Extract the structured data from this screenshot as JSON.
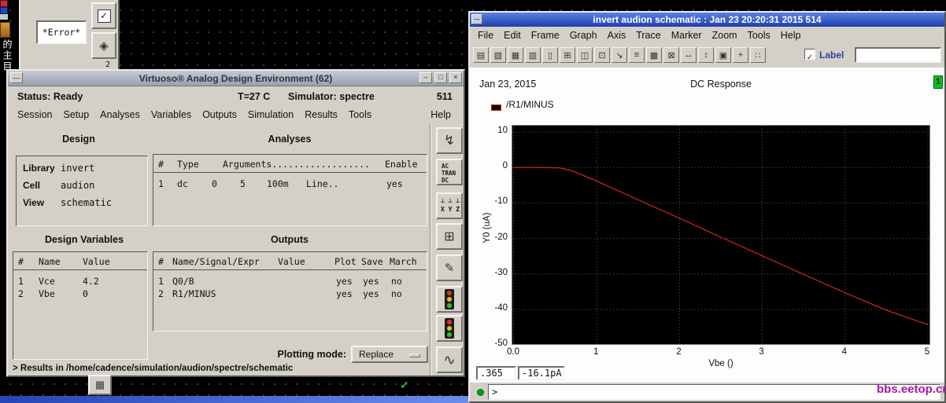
{
  "desktop": {
    "partial_icon_label": "的主目",
    "watermark": "bbs.eetop.cn",
    "check_mark": "✓",
    "minimized_icon_glyph": "▦"
  },
  "error_window": {
    "error_label": "*Error*",
    "check_icon_glyph": "✓",
    "skip_icon_glyph": "◈",
    "skip_icon_caption": "2"
  },
  "ade": {
    "title": "Virtuoso® Analog Design Environment (62)",
    "window_menu_glyph": "—",
    "minimize_glyph": "–",
    "maximize_glyph": "□",
    "close_glyph": "×",
    "status_label": "Status:",
    "status_value": "Ready",
    "temperature": "T=27 C",
    "simulator_label": "Simulator:",
    "simulator_value": "spectre",
    "run_number": "511",
    "menus": [
      "Session",
      "Setup",
      "Analyses",
      "Variables",
      "Outputs",
      "Simulation",
      "Results",
      "Tools"
    ],
    "help_menu": "Help",
    "design": {
      "title": "Design",
      "library_label": "Library",
      "library_value": "invert",
      "cell_label": "Cell",
      "cell_value": "audion",
      "view_label": "View",
      "view_value": "schematic"
    },
    "analyses": {
      "title": "Analyses",
      "columns": [
        "#",
        "Type",
        "Arguments..................",
        "Enable"
      ],
      "row": [
        "1",
        "dc",
        "0",
        "5",
        "100m",
        "Line..",
        "yes"
      ]
    },
    "design_variables": {
      "title": "Design Variables",
      "columns": [
        "#",
        "Name",
        "Value"
      ],
      "rows": [
        [
          "1",
          "Vce",
          "4.2"
        ],
        [
          "2",
          "Vbe",
          "0"
        ]
      ]
    },
    "outputs": {
      "title": "Outputs",
      "columns": [
        "#",
        "Name/Signal/Expr",
        "Value",
        "Plot",
        "Save",
        "March"
      ],
      "rows": [
        [
          "1",
          "Q0/B",
          "yes",
          "yes",
          "no"
        ],
        [
          "2",
          "R1/MINUS",
          "yes",
          "yes",
          "no"
        ]
      ]
    },
    "plotting_mode_label": "Plotting mode:",
    "plotting_mode_value": "Replace",
    "results_line": "> Results in /home/cadence/simulation/audion/spectre/schematic",
    "side_icons": {
      "probe_glyph": "↯",
      "ac_tran_dc_lines": [
        "AC",
        "TRAN",
        "DC"
      ],
      "xyz_lines": [
        "┴ ┴ ┴",
        "X Y Z"
      ],
      "outputs_setup_glyph": "⊞",
      "annotate_glyph": "✎",
      "waveform_glyph": "∿"
    }
  },
  "waveform": {
    "title": "invert audion schematic : Jan 23 20:20:31 2015 514",
    "window_menu_glyph": "—",
    "menus": [
      "File",
      "Edit",
      "Frame",
      "Graph",
      "Axis",
      "Trace",
      "Marker",
      "Zoom",
      "Tools",
      "Help"
    ],
    "toolbar_icons": [
      {
        "name": "print-icon",
        "glyph": "▤"
      },
      {
        "name": "export-image-icon",
        "glyph": "▧"
      },
      {
        "name": "grid-toggle-icon",
        "glyph": "▦"
      },
      {
        "name": "strip-mode-icon",
        "glyph": "▥"
      },
      {
        "name": "single-window-icon",
        "glyph": "▯"
      },
      {
        "name": "subwindow-icon",
        "glyph": "⊞"
      },
      {
        "name": "overlay-icon",
        "glyph": "◫"
      },
      {
        "name": "copy-graph-icon",
        "glyph": "⊡"
      },
      {
        "name": "export-data-icon",
        "glyph": "↘"
      },
      {
        "name": "edit-labels-icon",
        "glyph": "≡"
      },
      {
        "name": "fill-style-icon",
        "glyph": "▩"
      },
      {
        "name": "select-region-icon",
        "glyph": "⊠"
      },
      {
        "name": "zoom-x-icon",
        "glyph": "↔"
      },
      {
        "name": "zoom-y-icon",
        "glyph": "↕"
      },
      {
        "name": "zoom-fit-icon",
        "glyph": "▣"
      },
      {
        "name": "pan-icon",
        "glyph": "+"
      },
      {
        "name": "crosshair-icon",
        "glyph": "∷"
      }
    ],
    "label_checkbox_glyph": "✓",
    "label_checkbox_label": "Label",
    "label_field_value": "",
    "date": "Jan 23, 2015",
    "plot_title": "DC Response",
    "page_badge": "1",
    "x_readout": ".365",
    "y_readout": "-16.1pA",
    "prompt": ">",
    "chart_data": {
      "type": "line",
      "title": "DC Response",
      "xlabel": "Vbe ()",
      "ylabel": "Y0 (uA)",
      "xlim": [
        0,
        5
      ],
      "ylim": [
        -50,
        10
      ],
      "x_ticks": [
        "0.0",
        "1",
        "2",
        "3",
        "4",
        "5"
      ],
      "x_ticks_num": [
        0,
        1,
        2,
        3,
        4,
        5
      ],
      "y_ticks": [
        "10",
        "0",
        "-10",
        "-20",
        "-30",
        "-40",
        "-50"
      ],
      "y_ticks_num": [
        10,
        0,
        -10,
        -20,
        -30,
        -40,
        -50
      ],
      "grid": true,
      "background": "#000000",
      "legend_position": "top-left",
      "series": [
        {
          "name": "/R1/MINUS",
          "color": "#cc2020",
          "points": [
            [
              0,
              0
            ],
            [
              0.3,
              0
            ],
            [
              0.55,
              -0.1
            ],
            [
              0.7,
              -0.9
            ],
            [
              1,
              -3.8
            ],
            [
              1.5,
              -9.1
            ],
            [
              2,
              -14.3
            ],
            [
              2.5,
              -19.6
            ],
            [
              3,
              -24.9
            ],
            [
              3.5,
              -30.1
            ],
            [
              4,
              -35.3
            ],
            [
              4.5,
              -40.2
            ],
            [
              5,
              -44.3
            ]
          ]
        }
      ]
    }
  }
}
